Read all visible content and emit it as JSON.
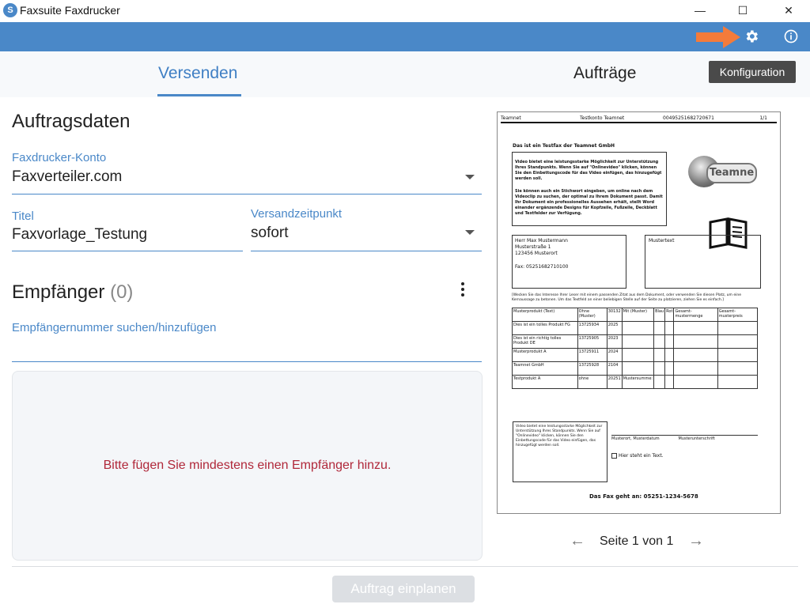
{
  "app": {
    "title": "Faxsuite Faxdrucker",
    "icon_glyph": "S"
  },
  "window_controls": {
    "minimize": "—",
    "maximize": "☐",
    "close": "✕"
  },
  "toolbar": {
    "gear_icon": "gear-icon",
    "info_icon": "info-icon",
    "tooltip": "Konfiguration",
    "highlight_color": "#f47b3a"
  },
  "tabs": [
    {
      "label": "Versenden",
      "active": true
    },
    {
      "label": "Aufträge",
      "active": false
    }
  ],
  "section_job": {
    "heading": "Auftragsdaten",
    "account_label": "Faxdrucker-Konto",
    "account_value": "Faxverteiler.com",
    "title_label": "Titel",
    "title_value": "Faxvorlage_Testung",
    "time_label": "Versandzeitpunkt",
    "time_value": "sofort"
  },
  "section_recipients": {
    "heading": "Empfänger",
    "count": "(0)",
    "search_placeholder": "Empfängernummer suchen/hinzufügen",
    "empty_message": "Bitte fügen Sie mindestens einen Empfänger hinzu."
  },
  "footer": {
    "submit_label": "Auftrag einplanen"
  },
  "pager": {
    "text": "Seite 1 von 1",
    "prev": "←",
    "next": "→"
  },
  "preview": {
    "header_left": "Teamnet",
    "header_mid": "Testkonto Teamnet",
    "header_num": "00495251682720671",
    "header_page": "1/1",
    "headline": "Das ist ein Testfax der Teamnet GmbH",
    "intro_p1": "Video bietet eine leistungsstarke Möglichkeit zur Unterstützung Ihres Standpunkts. Wenn Sie auf \"Onlinevideo\" klicken, können Sie den Einbettungscode für das Video einfügen, das hinzugefügt werden soll.",
    "intro_p2": "Sie können auch ein Stichwort eingeben, um online nach dem Videoclip zu suchen, der optimal zu Ihrem Dokument passt. Damit Ihr Dokument ein professionelles Aussehen erhält, stellt Word einander ergänzende Designs für Kopfzeile, Fußzeile, Deckblatt und Textfelder zur Verfügung.",
    "logo_text": "Teamne",
    "address": [
      "Herr Max Mustermann",
      "Musterstraße 1",
      "123456 Musterort",
      "Fax: 05251682710100"
    ],
    "musterbox": "Mustertext",
    "note": "[Wecken Sie das Interesse Ihrer Leser mit einem passenden Zitat aus dem Dokument, oder verwenden Sie diesen Platz, um eine Kernaussage zu betonen. Um das Textfeld an einer beliebigen Stelle auf der Seite zu platzieren, ziehen Sie es einfach.]",
    "table": [
      [
        "Musterprodukt (Text)",
        "Ohne (Muster)",
        "30132",
        "Mit (Muster)",
        "Blau",
        "Rot",
        "Gesamt-mustermenge",
        "Gesamt-musterpreis"
      ],
      [
        "Dies ist ein tolles Produkt FG",
        "13725934",
        "2025",
        "",
        "",
        "",
        "",
        ""
      ],
      [
        "Dies ist ein richtig tolles Produkt DE",
        "13725905",
        "2023",
        "",
        "",
        "",
        "",
        ""
      ],
      [
        "Musterprodukt A",
        "13725911",
        "2024",
        "",
        "",
        "",
        "",
        ""
      ],
      [
        "Teamnet GmbH",
        "13725928",
        "2104",
        "",
        "",
        "",
        "",
        ""
      ],
      [
        "Testprodukt A",
        "ohne",
        "20251",
        "Mustersumme:",
        "",
        "",
        "",
        ""
      ]
    ],
    "bottom_box": "Video bietet eine leistungsstarke Möglichkeit zur Unterstützung Ihres Standpunkts. Wenn Sie auf \"Onlinevideo\" klicken, können Sie den Einbettungscode für das Video einfügen, das hinzugefügt werden soll.",
    "sig_line": "Musterort, Musterdatum               Musterunterschrift",
    "checkbox_text": "Hier steht ein Text.",
    "fax_to": "Das Fax geht an: 05251-1234-5678"
  }
}
